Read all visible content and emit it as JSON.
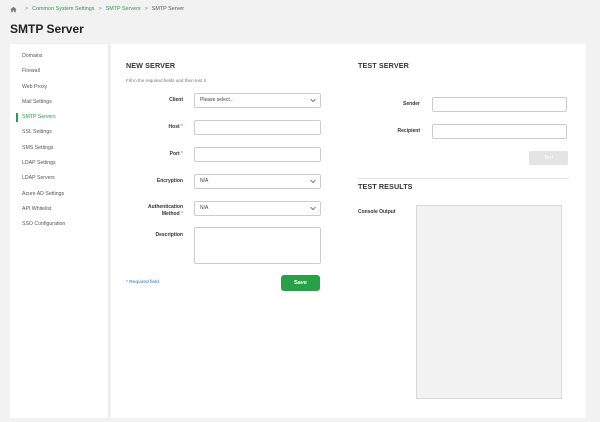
{
  "breadcrumb": {
    "items": [
      "Common System Settings",
      "SMTP Servers",
      "SMTP Server"
    ],
    "separator": ">"
  },
  "page": {
    "title": "SMTP Server"
  },
  "sidebar": {
    "items": [
      {
        "label": "Domains"
      },
      {
        "label": "Firewall"
      },
      {
        "label": "Web Proxy"
      },
      {
        "label": "Mail Settings"
      },
      {
        "label": "SMTP Servers",
        "active": true
      },
      {
        "label": "SSL Settings"
      },
      {
        "label": "SMS Settings"
      },
      {
        "label": "LDAP Settings"
      },
      {
        "label": "LDAP Servers"
      },
      {
        "label": "Azure AD Settings"
      },
      {
        "label": "API Whitelist"
      },
      {
        "label": "SSO Configuration"
      }
    ]
  },
  "new_server": {
    "title": "NEW SERVER",
    "hint": "Fill in the required fields and then test it",
    "client": {
      "label": "Client",
      "value": "Please select..."
    },
    "host": {
      "label": "Host",
      "required_mark": "*",
      "value": ""
    },
    "port": {
      "label": "Port",
      "required_mark": "*",
      "value": ""
    },
    "encryption": {
      "label": "Encryption",
      "value": "N/A"
    },
    "auth_method": {
      "label_line1": "Authentication",
      "label_line2": "Method",
      "required_mark": "*",
      "value": "N/A"
    },
    "description": {
      "label": "Description",
      "value": ""
    },
    "required_note": "* Required field.",
    "save_label": "Save"
  },
  "test_server": {
    "title": "TEST SERVER",
    "sender": {
      "label": "Sender",
      "value": ""
    },
    "recipient": {
      "label": "Recipient",
      "value": ""
    },
    "test_label": "Test"
  },
  "test_results": {
    "title": "TEST RESULTS",
    "console_label": "Console Output"
  },
  "colors": {
    "accent": "#27a046",
    "link_blue": "#2a6fb0",
    "required_red": "#d9534f",
    "background": "#f2f2f2"
  },
  "icons": {
    "home": "home-icon",
    "chevron": "chevron-down-icon"
  }
}
